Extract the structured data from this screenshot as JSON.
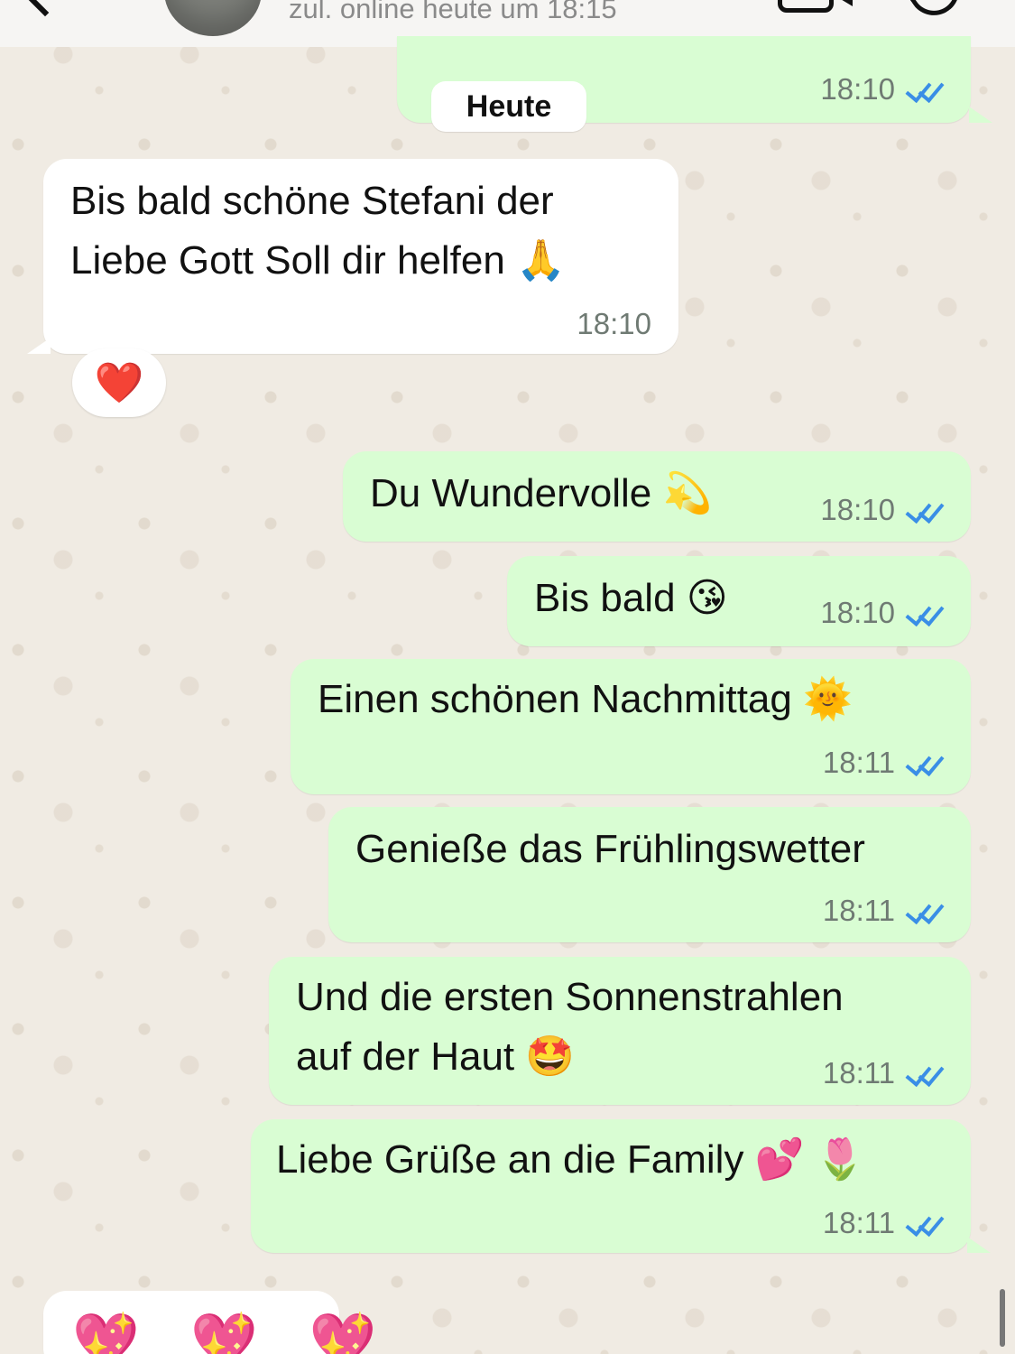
{
  "header": {
    "last_seen": "zul. online heute um 18:15"
  },
  "date_separator": "Heute",
  "messages": [
    {
      "direction": "out",
      "text": "",
      "time": "18:10"
    },
    {
      "direction": "in",
      "line1": "Bis bald schöne Stefani der",
      "line2": "Liebe Gott Soll dir helfen 🙏",
      "time": "18:10",
      "reaction": "❤️"
    },
    {
      "direction": "out",
      "text": "Du Wundervolle 💫",
      "time": "18:10"
    },
    {
      "direction": "out",
      "text": "Bis bald 😘",
      "time": "18:10"
    },
    {
      "direction": "out",
      "text": "Einen schönen Nachmittag 🌞",
      "time": "18:11"
    },
    {
      "direction": "out",
      "text": "Genieße das Frühlingswetter",
      "time": "18:11"
    },
    {
      "direction": "out",
      "line1": "Und die ersten Sonnenstrahlen",
      "line2": "auf der Haut 🤩",
      "time": "18:11"
    },
    {
      "direction": "out",
      "text": "Liebe Grüße an die Family 💕 🌷",
      "time": "18:11"
    },
    {
      "direction": "in",
      "text": "💖 💖 💖"
    }
  ]
}
